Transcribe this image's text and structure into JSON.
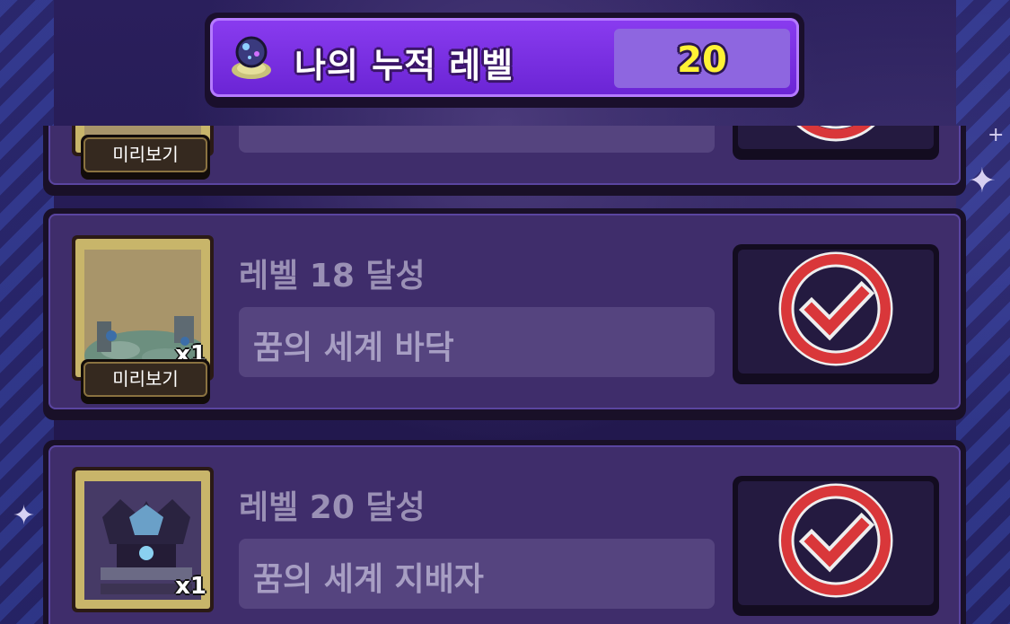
{
  "header": {
    "title": "나의 누적 레벨",
    "value": "20",
    "icon": "dream-orb-icon"
  },
  "rewards": [
    {
      "level_label": "",
      "reward_name": "",
      "quantity": "",
      "preview_label": "미리보기",
      "status": "claimed"
    },
    {
      "level_label": "레벨 18 달성",
      "reward_name": "꿈의 세계 바닥",
      "quantity": "x1",
      "preview_label": "미리보기",
      "status": "claimed"
    },
    {
      "level_label": "레벨 20 달성",
      "reward_name": "꿈의 세계 지배자",
      "quantity": "x1",
      "preview_label": "",
      "status": "claimed"
    }
  ],
  "colors": {
    "accent": "#7a33e8",
    "level_value": "#fff235",
    "claimed_check": "#d9373a"
  }
}
